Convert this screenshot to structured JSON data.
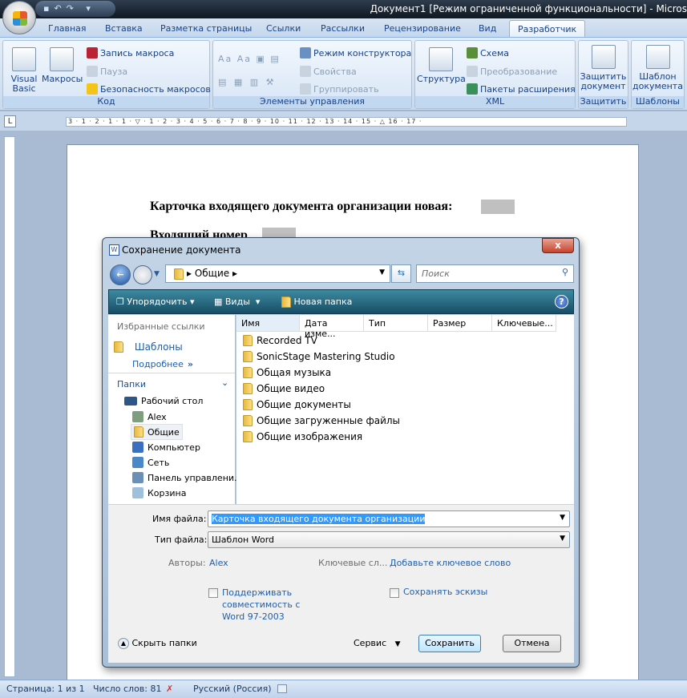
{
  "window": {
    "title": "Документ1 [Режим ограниченной функциональности] - Micros"
  },
  "qat": {
    "icons": "save-icon undo-icon redo-icon customize-icon"
  },
  "tabs": [
    "Главная",
    "Вставка",
    "Разметка страницы",
    "Ссылки",
    "Рассылки",
    "Рецензирование",
    "Вид",
    "Разработчик"
  ],
  "ribbon": {
    "code": {
      "label": "Код",
      "visual_basic": "Visual Basic",
      "macros": "Макросы",
      "record": "Запись макроса",
      "pause": "Пауза",
      "security": "Безопасность макросов"
    },
    "controls": {
      "label": "Элементы управления",
      "design_mode": "Режим конструктора",
      "properties": "Свойства",
      "group": "Группировать"
    },
    "xml": {
      "label": "XML",
      "structure": "Структура",
      "schema": "Схема",
      "transform": "Преобразование",
      "packs": "Пакеты расширения"
    },
    "protect": {
      "label": "Защитить",
      "protect_doc": "Защитить документ"
    },
    "templates": {
      "label": "Шаблоны",
      "doc_template": "Шаблон документа"
    }
  },
  "ruler": {
    "marks": "3 · 1 · 2 · 1 · 1 · ▽ · 1 · 2 · 3 · 4 · 5 · 6 · 7 · 8 · 9 · 10 · 11 · 12 · 13 · 14 · 15 · △ 16 · 17 ·"
  },
  "document": {
    "line1": "Карточка  входящего документа организации новая:",
    "line2": "Входящий номер"
  },
  "dialog": {
    "title": "Сохранение документа",
    "close": "x",
    "address": "▸ Общие ▸",
    "search_placeholder": "Поиск",
    "toolbar": {
      "organize": "Упорядочить",
      "views": "Виды",
      "new_folder": "Новая папка",
      "help": "?"
    },
    "favorites_header": "Избранные ссылки",
    "favorites": [
      "Шаблоны"
    ],
    "more": "Подробнее",
    "folders_header": "Папки",
    "tree": [
      "Рабочий стол",
      "Alex",
      "Общие",
      "Компьютер",
      "Сеть",
      "Панель управлени.",
      "Корзина"
    ],
    "columns": [
      "Имя",
      "Дата изме...",
      "Тип",
      "Размер",
      "Ключевые..."
    ],
    "files": [
      "Recorded TV",
      "SonicStage Mastering Studio",
      "Общая музыка",
      "Общие видео",
      "Общие документы",
      "Общие загруженные файлы",
      "Общие изображения"
    ],
    "filename_label": "Имя файла:",
    "filename": "Карточка  входящего документа организации",
    "filetype_label": "Тип файла:",
    "filetype": "Шаблон Word",
    "authors_label": "Авторы:",
    "authors": "Alex",
    "keywords_label": "Ключевые сл...",
    "keywords": "Добавьте ключевое слово",
    "compat": "Поддерживать совместимость с Word 97-2003",
    "thumbs": "Сохранять эскизы",
    "hide_folders": "Скрыть папки",
    "tools": "Сервис",
    "save": "Сохранить",
    "cancel": "Отмена"
  },
  "status": {
    "page": "Страница: 1 из 1",
    "words": "Число слов: 81",
    "lang": "Русский (Россия)"
  }
}
